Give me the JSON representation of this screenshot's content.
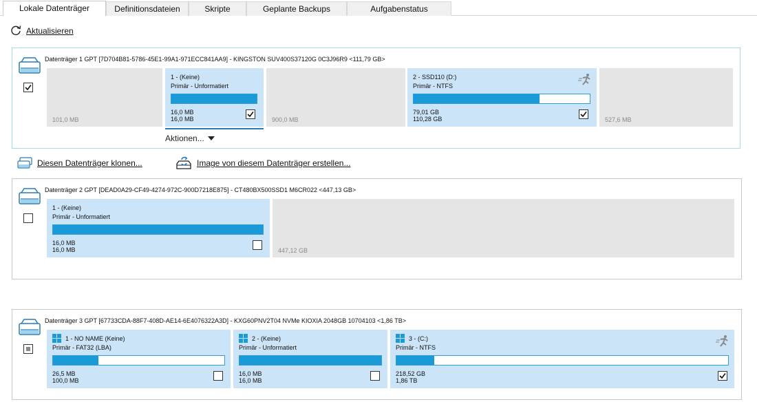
{
  "tabs": [
    "Lokale Datenträger",
    "Definitionsdateien",
    "Skripte",
    "Geplante Backups",
    "Aufgabenstatus"
  ],
  "toolbar": {
    "refresh_label": "Aktualisieren"
  },
  "disk1": {
    "title": "Datenträger 1 GPT [7D704B81-5786-45E1-99A1-971ECC841AA9] - KINGSTON SUV400S37120G 0C3J96R9  <111,79 GB>",
    "checked": true,
    "partitions": [
      {
        "kind": "empty",
        "size": "101,0 MB"
      },
      {
        "kind": "used",
        "name": "1 -  (Keine)",
        "type": "Primär - Unformatiert",
        "used": "16,0 MB",
        "total": "16,0 MB",
        "fill": 1.0,
        "checked": true,
        "selected": true
      },
      {
        "kind": "empty",
        "size": "900,0 MB"
      },
      {
        "kind": "used",
        "name": "2 - SSD110 (D:)",
        "type": "Primär - NTFS",
        "used": "79,01 GB",
        "total": "110,28 GB",
        "fill": 0.716,
        "checked": true,
        "icon": "runner-icon"
      },
      {
        "kind": "empty",
        "size": "527,6 MB"
      }
    ],
    "actions_label": "Aktionen..."
  },
  "operations": {
    "clone_label": "Diesen Datenträger klonen...",
    "image_label": "Image von diesem Datenträger erstellen..."
  },
  "disk2": {
    "title": "Datenträger 2 GPT [DEAD0A29-CF49-4274-972C-900D7218E875] - CT480BX500SSD1  M6CR022  <447,13 GB>",
    "checked": false,
    "partitions": [
      {
        "kind": "used",
        "name": "1 -  (Keine)",
        "type": "Primär - Unformatiert",
        "used": "16,0 MB",
        "total": "16,0 MB",
        "fill": 1.0,
        "checked": false
      },
      {
        "kind": "empty",
        "size": "447,12 GB"
      }
    ]
  },
  "disk3": {
    "title": "Datenträger 3 GPT [67733CDA-88F7-408D-AE14-6E4076322A3D] - KXG60PNV2T04 NVMe KIOXIA 2048GB 10704103  <1,86 TB>",
    "checked": "indeterminate",
    "partitions": [
      {
        "kind": "used",
        "name": "1 - NO NAME (Keine)",
        "type": "Primär - FAT32 (LBA)",
        "used": "26,5 MB",
        "total": "100,0 MB",
        "fill": 0.265,
        "checked": false,
        "icon": "windows-icon"
      },
      {
        "kind": "used",
        "name": "2 -  (Keine)",
        "type": "Primär - Unformatiert",
        "used": "16,0 MB",
        "total": "16,0 MB",
        "fill": 1.0,
        "checked": false,
        "icon": "windows-icon"
      },
      {
        "kind": "used",
        "name": "3 -  (C:)",
        "type": "Primär - NTFS",
        "used": "218,52 GB",
        "total": "1,86 TB",
        "fill": 0.115,
        "checked": true,
        "icon": "windows-icon",
        "icon2": "runner-icon"
      }
    ]
  },
  "colors": {
    "accent": "#1a9ad6",
    "partition_used": "#cce4f7",
    "partition_empty": "#e5e5e5",
    "selected_border": "#a9d9e2"
  }
}
